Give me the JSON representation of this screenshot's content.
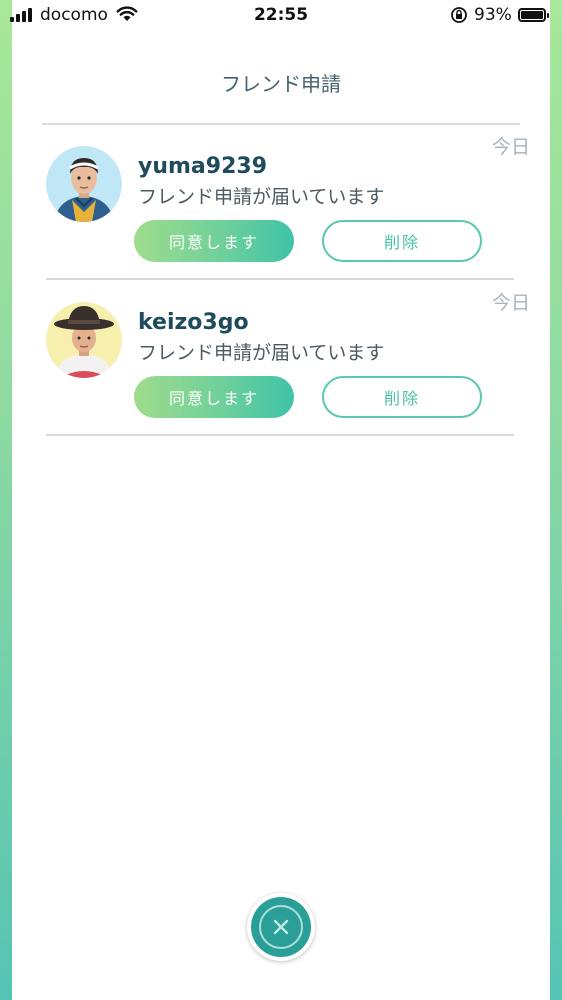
{
  "status_bar": {
    "carrier": "docomo",
    "time": "22:55",
    "battery_percent": "93%",
    "battery_level": 0.93,
    "icons": [
      "signal-icon",
      "wifi-icon",
      "rotation-lock-icon",
      "battery-icon"
    ]
  },
  "page": {
    "title": "フレンド申請"
  },
  "requests": [
    {
      "date": "今日",
      "username": "yuma9239",
      "message": "フレンド申請が届いています",
      "accept_label": "同意します",
      "delete_label": "削除"
    },
    {
      "date": "今日",
      "username": "keizo3go",
      "message": "フレンド申請が届いています",
      "accept_label": "同意します",
      "delete_label": "削除"
    }
  ],
  "close_button": {
    "icon": "close-icon"
  },
  "colors": {
    "accent_teal": "#2a9f97",
    "button_gradient_start": "#9fdc8c",
    "button_gradient_end": "#3fc3a8",
    "username": "#1f4b5d",
    "title": "#44626f"
  }
}
